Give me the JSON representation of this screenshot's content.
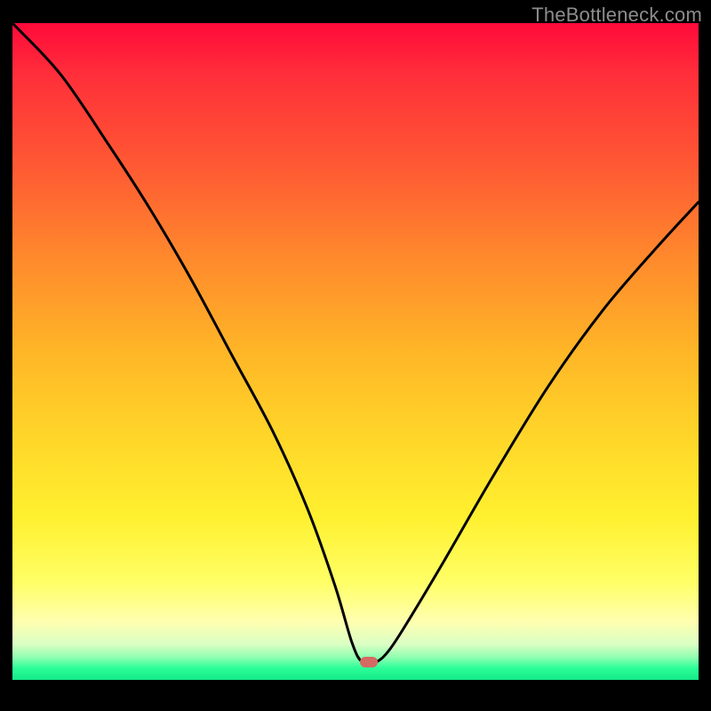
{
  "watermark": "TheBottleneck.com",
  "chart_data": {
    "type": "line",
    "title": "",
    "xlabel": "",
    "ylabel": "",
    "xlim": [
      0,
      100
    ],
    "ylim": [
      0,
      100
    ],
    "grid": false,
    "legend": false,
    "series": [
      {
        "name": "bottleneck-curve",
        "x": [
          0,
          7,
          14,
          20,
          26,
          32,
          38,
          43,
          47,
          49.5,
          51,
          53,
          55,
          58,
          63,
          70,
          78,
          86,
          94,
          100
        ],
        "values": [
          100,
          92,
          81,
          71,
          60,
          48,
          36,
          24,
          12,
          3,
          0,
          0,
          2,
          7,
          16,
          29,
          43,
          55,
          65,
          72
        ]
      }
    ],
    "marker": {
      "x": 52,
      "y": 0,
      "color": "#d46a62"
    },
    "background_gradient": [
      "#ff0a3a",
      "#ff5a33",
      "#ffb627",
      "#fff02f",
      "#ffffb0",
      "#2fff99"
    ]
  }
}
